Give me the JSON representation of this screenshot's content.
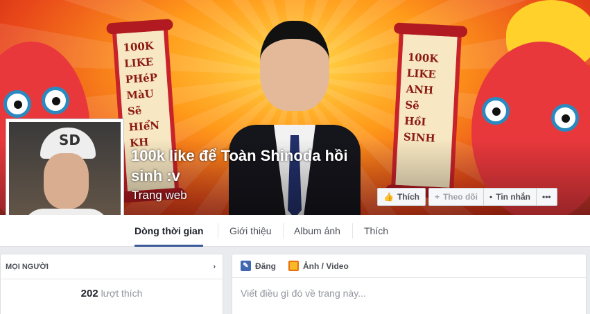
{
  "cover": {
    "scroll_left": [
      "100K",
      "LIKE",
      "PHéP",
      "MàU",
      "Sẽ",
      "HIểN",
      "KH"
    ],
    "scroll_right": [
      "100K",
      "LIKE",
      "ANH",
      "Sẽ",
      "HồI",
      "SINH"
    ]
  },
  "profile": {
    "cap_text": "SD"
  },
  "page": {
    "title": "100k like để Toàn Shinoda hồi sinh :v",
    "category": "Trang web"
  },
  "actions": {
    "like_label": "Thích",
    "follow_label": "Theo dõi",
    "message_label": "Tin nhắn",
    "more_label": "•••"
  },
  "tabs": [
    {
      "label": "Dòng thời gian"
    },
    {
      "label": "Giới thiệu"
    },
    {
      "label": "Album ảnh"
    },
    {
      "label": "Thích"
    }
  ],
  "people": {
    "header": "MỌI NGƯỜI",
    "like_count": "202",
    "like_suffix": "lượt thích"
  },
  "composer": {
    "post_tab": "Đăng",
    "photo_tab": "Ảnh / Video",
    "placeholder": "Viết điều gì đó về trang này..."
  }
}
